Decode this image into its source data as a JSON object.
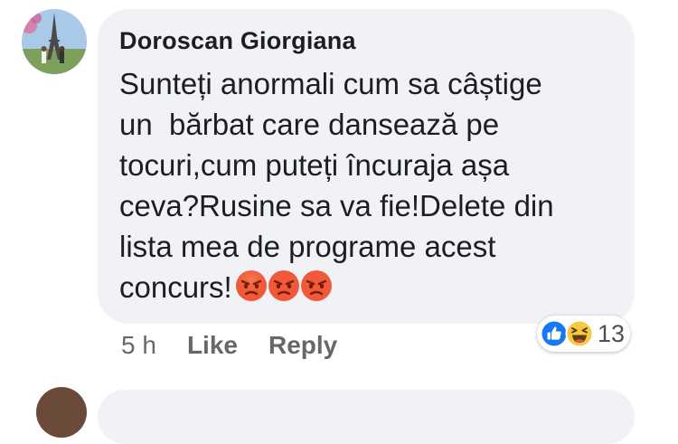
{
  "comment": {
    "author": "Doroscan Giorgiana",
    "text": "Sunteți anormali cum sa câștige\nun  bărbat care dansează pe\ntocuri,cum puteți încuraja așa\nceva?Rusine sa va fie!Delete din\nlista mea de programe acest\nconcurs!",
    "emojis": [
      "angry-face-icon",
      "angry-face-icon",
      "angry-face-icon"
    ],
    "time": "5 h",
    "like_label": "Like",
    "reply_label": "Reply",
    "reactions": {
      "icons": [
        "like-icon",
        "haha-icon"
      ],
      "count": "13"
    }
  },
  "colors": {
    "bubble": "#f0f2f5",
    "text": "#1c1e21",
    "meta": "#65676b",
    "like_blue": "#1877f2",
    "haha_yellow": "#f7c844"
  }
}
